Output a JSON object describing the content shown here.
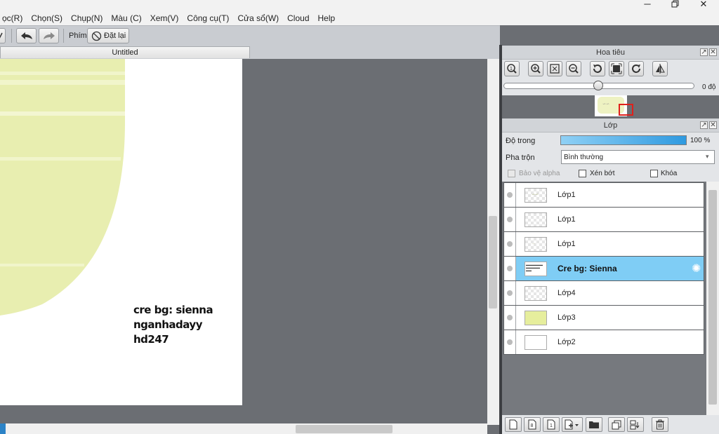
{
  "menubar": {
    "items": [
      "ọc(R)",
      "Chọn(S)",
      "Chụp(N)",
      "Màu (C)",
      "Xem(V)",
      "Công cụ(T)",
      "Cửa sổ(W)",
      "Cloud",
      "Help"
    ]
  },
  "toolbar": {
    "keys_label": "Phím",
    "reset_label": "Đặt lại"
  },
  "document": {
    "tab_title": "Untitled",
    "watermark_lines": [
      "cre bg: sienna",
      "nganhadayy",
      "hd247"
    ]
  },
  "navigator": {
    "title": "Hoa tiêu",
    "rotation_value": "0 độ"
  },
  "layers_panel": {
    "title": "Lớp",
    "opacity_label": "Độ trong",
    "opacity_value": "100 %",
    "opacity_fraction": 1.0,
    "blend_label": "Pha trộn",
    "blend_value": "Bình thường",
    "protect_alpha_label": "Bảo vệ alpha",
    "clip_label": "Xén bớt",
    "lock_label": "Khóa",
    "layers": [
      {
        "name": "Lớp1",
        "selected": false
      },
      {
        "name": "Lớp1",
        "selected": false
      },
      {
        "name": "Lớp1",
        "selected": false
      },
      {
        "name": "Cre bg: Sienna",
        "selected": true
      },
      {
        "name": "Lớp4",
        "selected": false
      },
      {
        "name": "Lớp3",
        "selected": false
      },
      {
        "name": "Lớp2",
        "selected": false
      }
    ]
  },
  "colors": {
    "selected_row": "#7fcdf5",
    "canvas_bg": "#6b6e73",
    "art_yellow": "#e8eeb0",
    "opacity_bar": "#2f9ae0"
  }
}
